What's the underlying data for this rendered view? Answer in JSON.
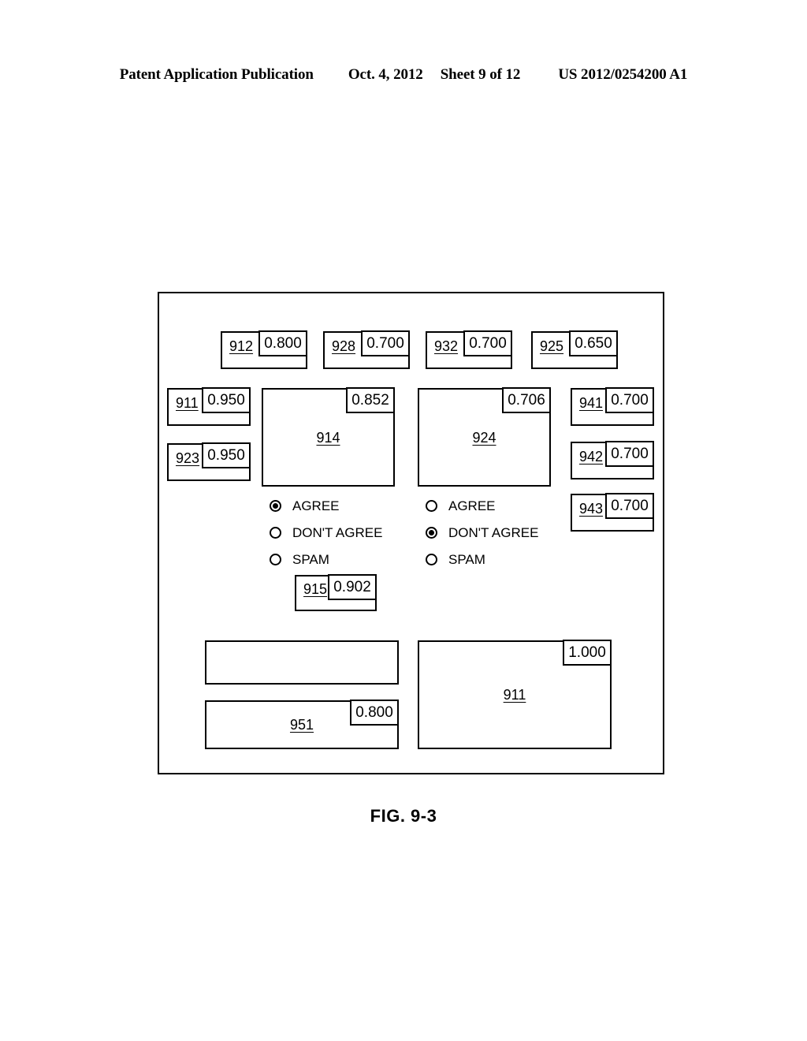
{
  "header": {
    "publication": "Patent Application Publication",
    "date": "Oct. 4, 2012",
    "sheet": "Sheet 9 of 12",
    "patent_number": "US 2012/0254200 A1"
  },
  "figure": {
    "caption": "FIG. 9-3",
    "top_row": [
      {
        "label": "912",
        "value": "0.800"
      },
      {
        "label": "928",
        "value": "0.700"
      },
      {
        "label": "932",
        "value": "0.700"
      },
      {
        "label": "925",
        "value": "0.650"
      }
    ],
    "left_column": [
      {
        "label": "911",
        "value": "0.950"
      },
      {
        "label": "923",
        "value": "0.950"
      }
    ],
    "center_panels": [
      {
        "label": "914",
        "value": "0.852"
      },
      {
        "label": "924",
        "value": "0.706"
      }
    ],
    "right_column": [
      {
        "label": "941",
        "value": "0.700"
      },
      {
        "label": "942",
        "value": "0.700"
      },
      {
        "label": "943",
        "value": "0.700"
      }
    ],
    "radio_groups": [
      {
        "name": "left",
        "options": [
          {
            "text": "AGREE",
            "selected": true
          },
          {
            "text": "DON'T AGREE",
            "selected": false
          },
          {
            "text": "SPAM",
            "selected": false
          }
        ]
      },
      {
        "name": "right",
        "options": [
          {
            "text": "AGREE",
            "selected": false
          },
          {
            "text": "DON'T AGREE",
            "selected": true
          },
          {
            "text": "SPAM",
            "selected": false
          }
        ]
      }
    ],
    "score_box": {
      "label": "915",
      "value": "0.902"
    },
    "bottom": {
      "empty_panel": {
        "label": "",
        "value": ""
      },
      "left_panel": {
        "label": "951",
        "value": "0.800"
      },
      "right_panel": {
        "label": "911",
        "value": "1.000"
      }
    }
  }
}
